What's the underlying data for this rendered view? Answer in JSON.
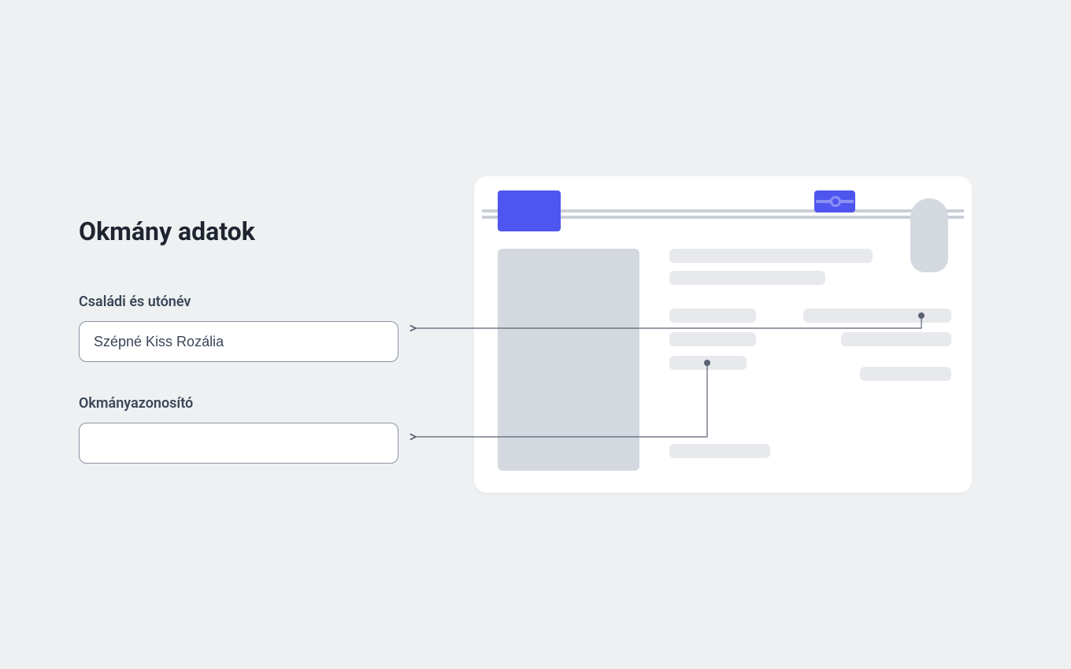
{
  "form": {
    "title": "Okmány adatok",
    "name": {
      "label": "Családi és utónév",
      "value": "Szépné Kiss Rozália"
    },
    "docid": {
      "label": "Okmányazonosító",
      "value": ""
    }
  }
}
